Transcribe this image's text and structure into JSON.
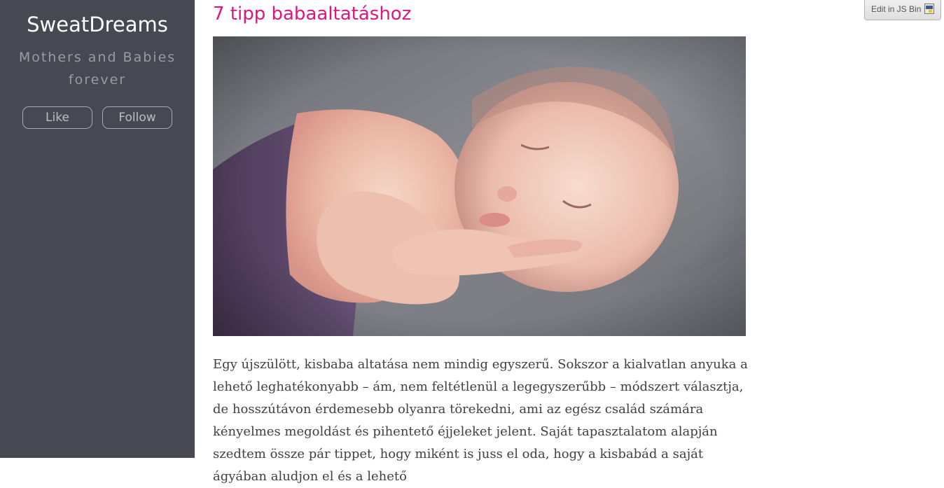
{
  "sidebar": {
    "title": "SweatDreams",
    "tagline": "Mothers and Babies forever",
    "like_label": "Like",
    "follow_label": "Follow"
  },
  "post": {
    "title": "7 tipp babaaltatáshoz",
    "body": "Egy újszülött, kisbaba altatása nem mindig egyszerű. Sokszor a kialvatlan anyuka a lehető leghatékonyabb – ám, nem feltétlenül a legegyszerűbb – módszert választja, de hosszútávon érdemesebb olyanra törekedni, ami az egész család számára kényelmes megoldást és pihentető éjjeleket jelent. Saját tapasztalatom alapján szedtem össze pár tippet, hogy miként is juss el oda, hogy a kisbabád a saját ágyában aludjon el és a lehető"
  },
  "jsbin": {
    "label": "Edit in JS Bin"
  },
  "colors": {
    "sidebar_bg": "#464852",
    "title_accent": "#e0157e",
    "body_text": "#3f3f46"
  }
}
